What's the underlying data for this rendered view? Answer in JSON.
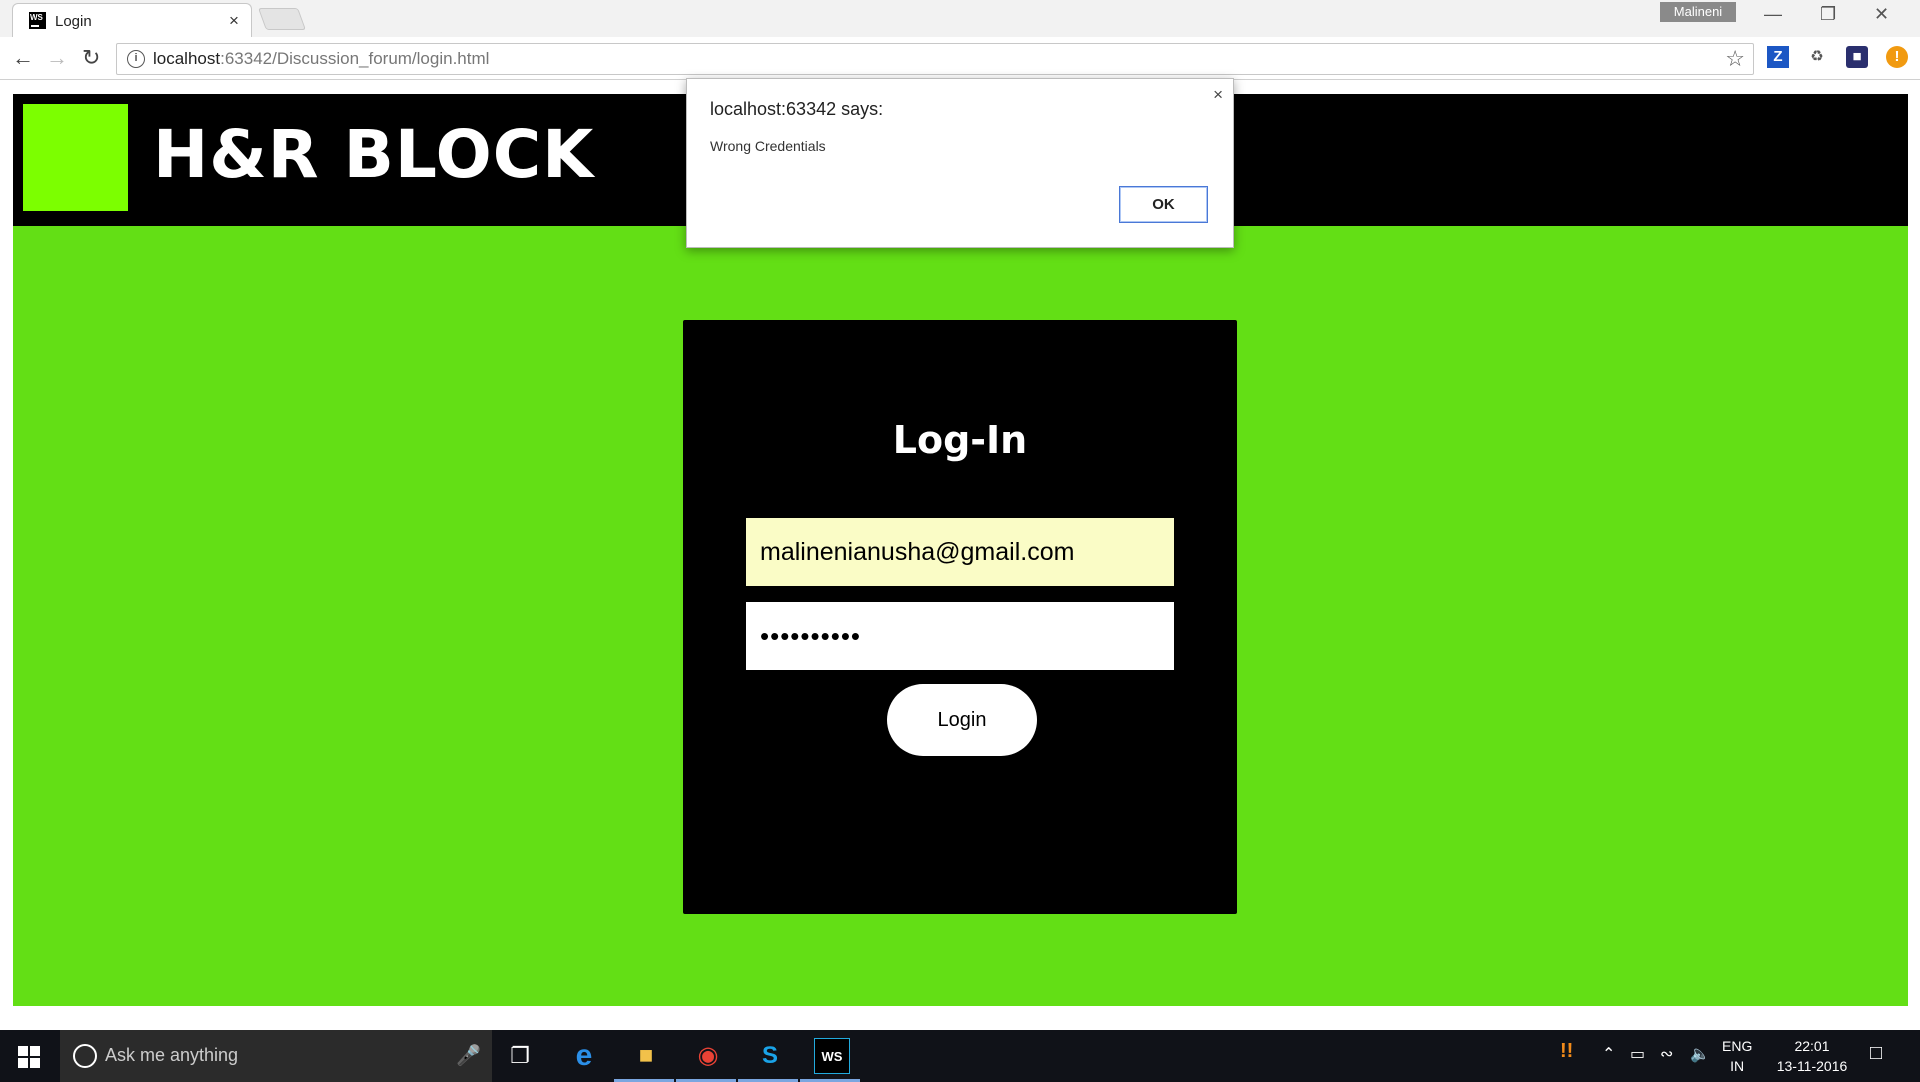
{
  "browser": {
    "tab_title": "Login",
    "tab_favicon": "WS",
    "tab_close": "×",
    "profile_name": "Malineni",
    "url_host": "localhost",
    "url_path": ":63342/Discussion_forum/login.html"
  },
  "page": {
    "brand": "H&R BLOCK",
    "login_title": "Log-In",
    "email_value": "malinenianusha@gmail.com",
    "password_value": "••••••••••",
    "login_button": "Login",
    "colors": {
      "background": "#63df15",
      "header": "#000000",
      "logo_square": "#7cff00",
      "email_autofill": "#fafcc6"
    }
  },
  "alert": {
    "title": "localhost:63342 says:",
    "message": "Wrong Credentials",
    "ok_label": "OK",
    "close": "×"
  },
  "taskbar": {
    "search_placeholder": "Ask me anything",
    "language": "ENG",
    "region": "IN",
    "time": "22:01",
    "date": "13-11-2016"
  }
}
